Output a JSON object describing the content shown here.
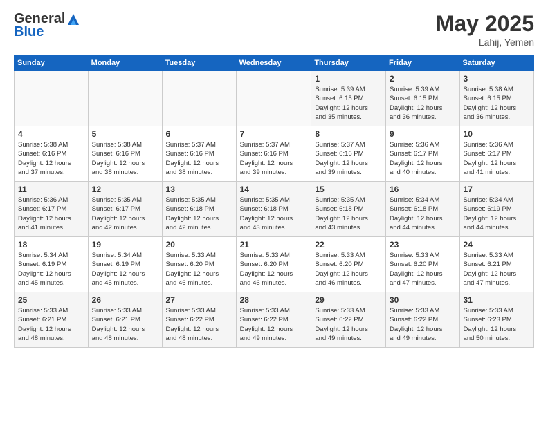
{
  "header": {
    "logo_general": "General",
    "logo_blue": "Blue",
    "month_year": "May 2025",
    "location": "Lahij, Yemen"
  },
  "weekdays": [
    "Sunday",
    "Monday",
    "Tuesday",
    "Wednesday",
    "Thursday",
    "Friday",
    "Saturday"
  ],
  "weeks": [
    [
      {
        "day": "",
        "info": ""
      },
      {
        "day": "",
        "info": ""
      },
      {
        "day": "",
        "info": ""
      },
      {
        "day": "",
        "info": ""
      },
      {
        "day": "1",
        "info": "Sunrise: 5:39 AM\nSunset: 6:15 PM\nDaylight: 12 hours\nand 35 minutes."
      },
      {
        "day": "2",
        "info": "Sunrise: 5:39 AM\nSunset: 6:15 PM\nDaylight: 12 hours\nand 36 minutes."
      },
      {
        "day": "3",
        "info": "Sunrise: 5:38 AM\nSunset: 6:15 PM\nDaylight: 12 hours\nand 36 minutes."
      }
    ],
    [
      {
        "day": "4",
        "info": "Sunrise: 5:38 AM\nSunset: 6:16 PM\nDaylight: 12 hours\nand 37 minutes."
      },
      {
        "day": "5",
        "info": "Sunrise: 5:38 AM\nSunset: 6:16 PM\nDaylight: 12 hours\nand 38 minutes."
      },
      {
        "day": "6",
        "info": "Sunrise: 5:37 AM\nSunset: 6:16 PM\nDaylight: 12 hours\nand 38 minutes."
      },
      {
        "day": "7",
        "info": "Sunrise: 5:37 AM\nSunset: 6:16 PM\nDaylight: 12 hours\nand 39 minutes."
      },
      {
        "day": "8",
        "info": "Sunrise: 5:37 AM\nSunset: 6:16 PM\nDaylight: 12 hours\nand 39 minutes."
      },
      {
        "day": "9",
        "info": "Sunrise: 5:36 AM\nSunset: 6:17 PM\nDaylight: 12 hours\nand 40 minutes."
      },
      {
        "day": "10",
        "info": "Sunrise: 5:36 AM\nSunset: 6:17 PM\nDaylight: 12 hours\nand 41 minutes."
      }
    ],
    [
      {
        "day": "11",
        "info": "Sunrise: 5:36 AM\nSunset: 6:17 PM\nDaylight: 12 hours\nand 41 minutes."
      },
      {
        "day": "12",
        "info": "Sunrise: 5:35 AM\nSunset: 6:17 PM\nDaylight: 12 hours\nand 42 minutes."
      },
      {
        "day": "13",
        "info": "Sunrise: 5:35 AM\nSunset: 6:18 PM\nDaylight: 12 hours\nand 42 minutes."
      },
      {
        "day": "14",
        "info": "Sunrise: 5:35 AM\nSunset: 6:18 PM\nDaylight: 12 hours\nand 43 minutes."
      },
      {
        "day": "15",
        "info": "Sunrise: 5:35 AM\nSunset: 6:18 PM\nDaylight: 12 hours\nand 43 minutes."
      },
      {
        "day": "16",
        "info": "Sunrise: 5:34 AM\nSunset: 6:18 PM\nDaylight: 12 hours\nand 44 minutes."
      },
      {
        "day": "17",
        "info": "Sunrise: 5:34 AM\nSunset: 6:19 PM\nDaylight: 12 hours\nand 44 minutes."
      }
    ],
    [
      {
        "day": "18",
        "info": "Sunrise: 5:34 AM\nSunset: 6:19 PM\nDaylight: 12 hours\nand 45 minutes."
      },
      {
        "day": "19",
        "info": "Sunrise: 5:34 AM\nSunset: 6:19 PM\nDaylight: 12 hours\nand 45 minutes."
      },
      {
        "day": "20",
        "info": "Sunrise: 5:33 AM\nSunset: 6:20 PM\nDaylight: 12 hours\nand 46 minutes."
      },
      {
        "day": "21",
        "info": "Sunrise: 5:33 AM\nSunset: 6:20 PM\nDaylight: 12 hours\nand 46 minutes."
      },
      {
        "day": "22",
        "info": "Sunrise: 5:33 AM\nSunset: 6:20 PM\nDaylight: 12 hours\nand 46 minutes."
      },
      {
        "day": "23",
        "info": "Sunrise: 5:33 AM\nSunset: 6:20 PM\nDaylight: 12 hours\nand 47 minutes."
      },
      {
        "day": "24",
        "info": "Sunrise: 5:33 AM\nSunset: 6:21 PM\nDaylight: 12 hours\nand 47 minutes."
      }
    ],
    [
      {
        "day": "25",
        "info": "Sunrise: 5:33 AM\nSunset: 6:21 PM\nDaylight: 12 hours\nand 48 minutes."
      },
      {
        "day": "26",
        "info": "Sunrise: 5:33 AM\nSunset: 6:21 PM\nDaylight: 12 hours\nand 48 minutes."
      },
      {
        "day": "27",
        "info": "Sunrise: 5:33 AM\nSunset: 6:22 PM\nDaylight: 12 hours\nand 48 minutes."
      },
      {
        "day": "28",
        "info": "Sunrise: 5:33 AM\nSunset: 6:22 PM\nDaylight: 12 hours\nand 49 minutes."
      },
      {
        "day": "29",
        "info": "Sunrise: 5:33 AM\nSunset: 6:22 PM\nDaylight: 12 hours\nand 49 minutes."
      },
      {
        "day": "30",
        "info": "Sunrise: 5:33 AM\nSunset: 6:22 PM\nDaylight: 12 hours\nand 49 minutes."
      },
      {
        "day": "31",
        "info": "Sunrise: 5:33 AM\nSunset: 6:23 PM\nDaylight: 12 hours\nand 50 minutes."
      }
    ]
  ]
}
